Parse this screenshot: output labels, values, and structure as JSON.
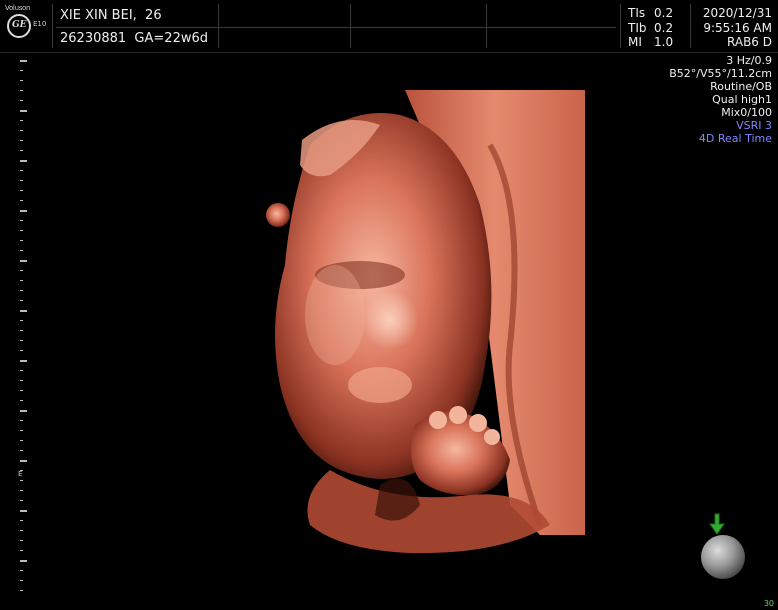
{
  "header": {
    "brand": "Voluson",
    "model": "E10",
    "patient_name": "XIE XIN BEI,  26",
    "patient_id_ga": "26230881  GA=22w6d",
    "ti": [
      {
        "label": "TIs",
        "value": "0.2"
      },
      {
        "label": "TIb",
        "value": "0.2"
      },
      {
        "label": "MI",
        "value": "1.0"
      }
    ],
    "date": "2020/12/31",
    "time": "9:55:16 AM",
    "probe": "RAB6 D"
  },
  "info_panel": {
    "lines": [
      "3 Hz/0.9",
      "B52°/V55°/11.2cm",
      "Routine/OB",
      "Qual high1",
      "Mix0/100"
    ],
    "vsri": "VSRI 3",
    "mode": "4D Real Time"
  },
  "scale": {
    "mark": "E"
  },
  "footer": {
    "corner_number": "30"
  },
  "colors": {
    "background": "#000000",
    "render_tone": "#d9735a",
    "accent_blue": "#7f86ff",
    "orientation_arrow": "#2fae2f"
  },
  "icons": {
    "logo": "ge-logo-icon",
    "orientation": "orientation-sphere-icon"
  }
}
